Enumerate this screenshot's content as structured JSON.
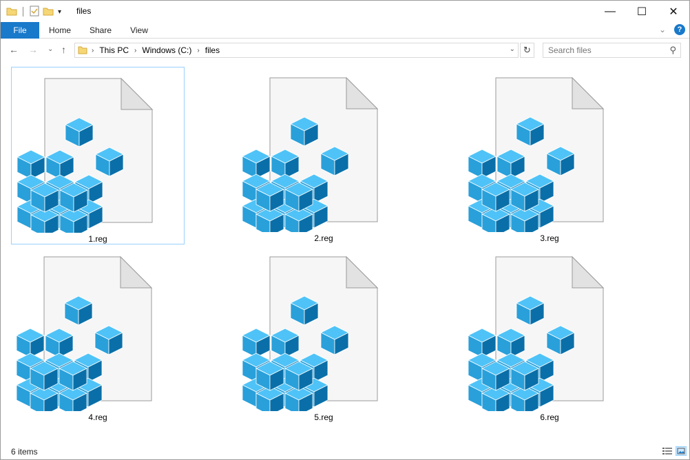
{
  "window": {
    "title": "files",
    "controls": {
      "minimize": "—",
      "maximize": "☐",
      "close": "✕"
    }
  },
  "ribbon": {
    "tabs": [
      {
        "label": "File"
      },
      {
        "label": "Home"
      },
      {
        "label": "Share"
      },
      {
        "label": "View"
      }
    ]
  },
  "address": {
    "crumbs": [
      "This PC",
      "Windows (C:)",
      "files"
    ]
  },
  "search": {
    "placeholder": "Search files"
  },
  "files": [
    {
      "name": "1.reg",
      "selected": true
    },
    {
      "name": "2.reg",
      "selected": false
    },
    {
      "name": "3.reg",
      "selected": false
    },
    {
      "name": "4.reg",
      "selected": false
    },
    {
      "name": "5.reg",
      "selected": false
    },
    {
      "name": "6.reg",
      "selected": false
    }
  ],
  "status": {
    "count": "6 items"
  },
  "colors": {
    "accent": "#1979ca",
    "cube_light": "#4fc3f7",
    "cube_mid": "#29a0da",
    "cube_dark": "#0a6fa8"
  }
}
